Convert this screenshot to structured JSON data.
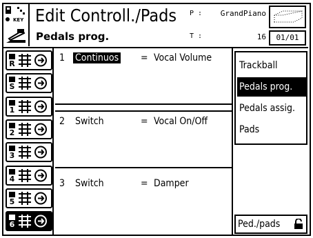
{
  "header": {
    "title": "Edit Controll./Pads",
    "subtitle": "Pedals prog.",
    "p_label": "P :",
    "p_value": "GrandPiano",
    "t_label": "T :",
    "t_value": "16",
    "page": "01/01"
  },
  "left_buttons": [
    {
      "label": "R"
    },
    {
      "label": "S"
    },
    {
      "label": "1"
    },
    {
      "label": "2"
    },
    {
      "label": "3"
    },
    {
      "label": "4"
    },
    {
      "label": "5"
    },
    {
      "label": "6"
    }
  ],
  "rows": [
    {
      "num": "1",
      "type": "Continuos",
      "eq": "=",
      "value": "Vocal Volume"
    },
    {
      "num": "2",
      "type": "Switch",
      "eq": "=",
      "value": "Vocal On/Off"
    },
    {
      "num": "3",
      "type": "Switch",
      "eq": "=",
      "value": "Damper"
    }
  ],
  "menu": {
    "items": [
      {
        "label": "Trackball"
      },
      {
        "label": "Pedals prog."
      },
      {
        "label": "Pedals assig."
      },
      {
        "label": "Pads"
      }
    ],
    "selected": "Pedals prog.",
    "bottom_button": "Ped./pads"
  },
  "icons": {
    "lock": "lock-icon",
    "keyboard": "keyboard-icon"
  }
}
